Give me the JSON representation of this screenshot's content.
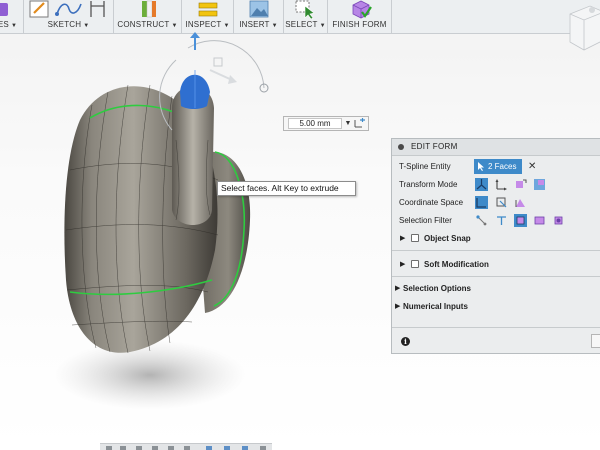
{
  "toolbar": {
    "groups": [
      {
        "label": "ES",
        "icon": "create-icon"
      },
      {
        "label": "SKETCH",
        "icon": "sketch-icon"
      },
      {
        "label": "CONSTRUCT",
        "icon": "construct-icon"
      },
      {
        "label": "INSPECT",
        "icon": "inspect-icon"
      },
      {
        "label": "INSERT",
        "icon": "insert-image-icon"
      },
      {
        "label": "SELECT",
        "icon": "select-icon"
      },
      {
        "label": "FINISH FORM",
        "icon": "finish-form-icon"
      }
    ],
    "dropdown_caret": "▼"
  },
  "distance_input": {
    "value": "5.00 mm",
    "caret": "▼"
  },
  "tooltip": {
    "text": "Select faces. Alt Key to extrude"
  },
  "edit_form": {
    "title": "EDIT FORM",
    "rows": {
      "tspline_entity": {
        "label": "T-Spline Entity",
        "value": "2 Faces",
        "clear": "✕"
      },
      "transform_mode": {
        "label": "Transform Mode"
      },
      "coordinate_space": {
        "label": "Coordinate Space"
      },
      "selection_filter": {
        "label": "Selection Filter"
      }
    },
    "sections": {
      "object_snap": {
        "label": "Object Snap",
        "checked": false
      },
      "soft_modification": {
        "label": "Soft Modification",
        "checked": false
      },
      "selection_options": {
        "label": "Selection Options"
      },
      "numerical_inputs": {
        "label": "Numerical Inputs"
      }
    },
    "info_glyph": "i"
  },
  "colors": {
    "accent": "#3e8ac9",
    "model_body": "#6e6a63",
    "selected_faces": "#2f6fd0",
    "edge_highlight": "#2ecc40",
    "toolbar_bg": "#eceff1",
    "panel_bg": "#ebedee"
  }
}
